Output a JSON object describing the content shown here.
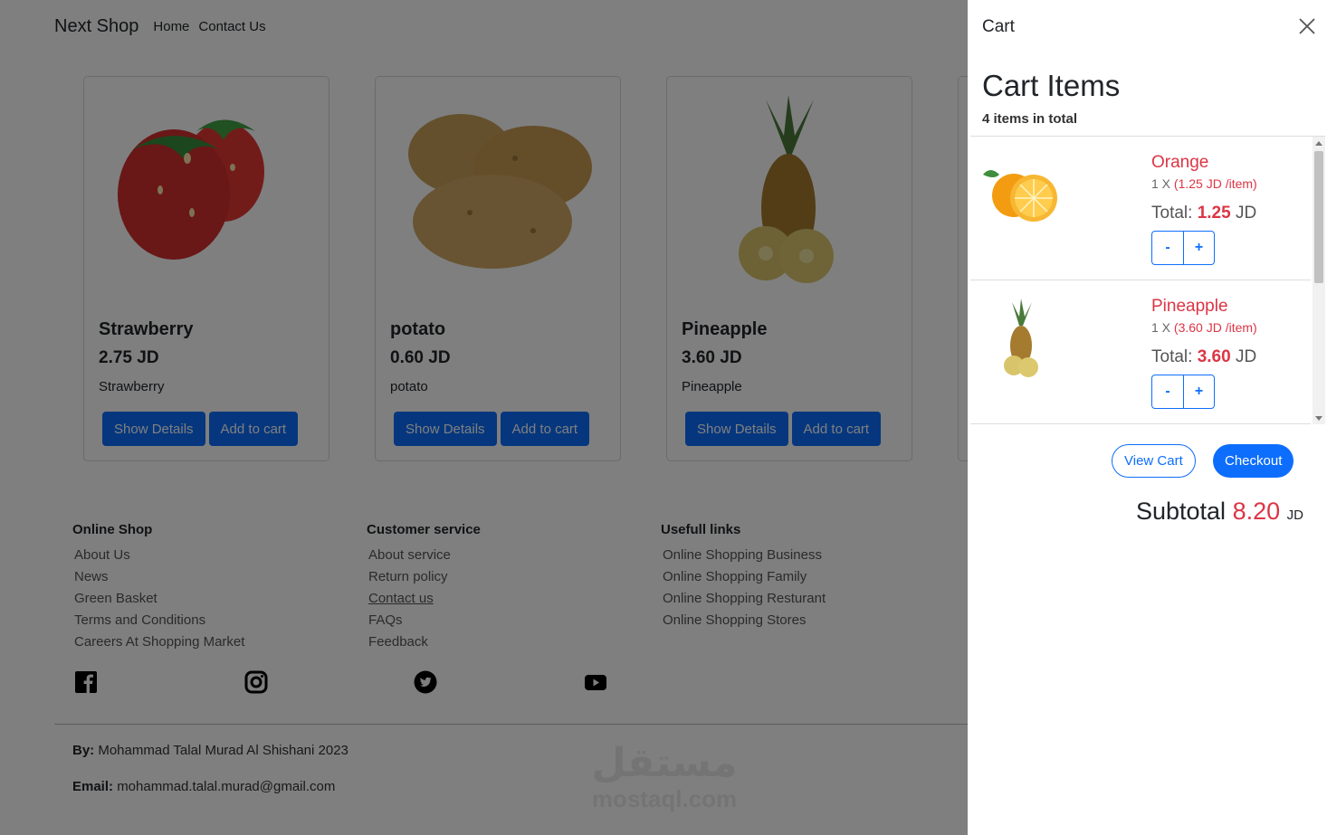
{
  "navbar": {
    "brand": "Next Shop",
    "links": [
      "Home",
      "Contact Us"
    ]
  },
  "products": [
    {
      "name": "Strawberry",
      "price": "2.75 JD",
      "description": "Strawberry",
      "details_label": "Show Details",
      "cart_label": "Add to cart"
    },
    {
      "name": "potato",
      "price": "0.60 JD",
      "description": "potato",
      "details_label": "Show Details",
      "cart_label": "Add to cart"
    },
    {
      "name": "Pineapple",
      "price": "3.60 JD",
      "description": "Pineapple",
      "details_label": "Show Details",
      "cart_label": "Add to cart"
    }
  ],
  "footer": {
    "columns": [
      {
        "heading": "Online Shop",
        "links": [
          "About Us",
          "News",
          "Green Basket",
          "Terms and Conditions",
          "Careers At Shopping Market"
        ]
      },
      {
        "heading": "Customer service",
        "links": [
          "About service",
          "Return policy",
          "Contact us",
          "FAQs",
          "Feedback"
        ]
      },
      {
        "heading": "Usefull links",
        "links": [
          "Online Shopping Business",
          "Online Shopping Family",
          "Online Shopping Resturant",
          "Online Shopping Stores"
        ]
      }
    ],
    "social_icons": [
      "facebook-icon",
      "instagram-icon",
      "twitter-icon",
      "youtube-icon"
    ],
    "by_label": "By:",
    "by_value": "Mohammad Talal Murad Al Shishani 2023",
    "email_label": "Email:",
    "email_value": "mohammad.talal.murad@gmail.com"
  },
  "watermark": {
    "arabic": "مستقل",
    "latin": "mostaql.com"
  },
  "cart": {
    "title": "Cart",
    "heading": "Cart Items",
    "count_text": "4 items in total",
    "items": [
      {
        "name": "Orange",
        "qty_prefix": "1 X",
        "unit_price": "(1.25 JD /item)",
        "total_label": "Total:",
        "total_value": "1.25",
        "currency": "JD",
        "minus": "-",
        "plus": "+"
      },
      {
        "name": "Pineapple",
        "qty_prefix": "1 X",
        "unit_price": "(3.60 JD /item)",
        "total_label": "Total:",
        "total_value": "3.60",
        "currency": "JD",
        "minus": "-",
        "plus": "+"
      }
    ],
    "view_cart_label": "View Cart",
    "checkout_label": "Checkout",
    "subtotal_label": "Subtotal",
    "subtotal_value": "8.20",
    "subtotal_currency": "JD"
  },
  "colors": {
    "primary": "#0d6efd",
    "danger": "#dc3545",
    "overlay": "rgba(0,0,0,0.5)"
  }
}
